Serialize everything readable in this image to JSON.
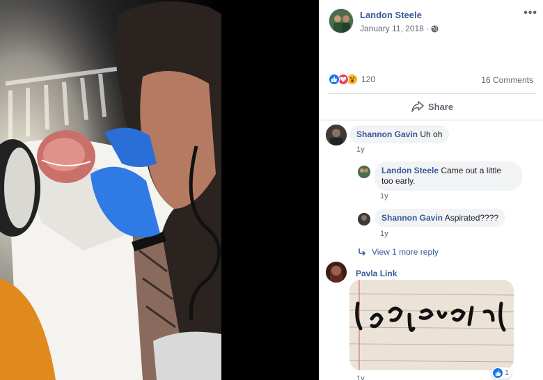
{
  "post": {
    "author": "Landon Steele",
    "date": "January 11, 2018 ·",
    "more_label": "•••",
    "reaction_count": "120",
    "comments_count": "16 Comments",
    "share_label": "Share",
    "reactions": [
      "like-icon",
      "love-icon",
      "wow-icon"
    ]
  },
  "comments": [
    {
      "author": "Shannon Gavin",
      "text": "Uh oh",
      "time": "1y"
    },
    {
      "author": "Landon Steele",
      "text": "Came out a little too early.",
      "time": "1y"
    },
    {
      "author": "Shannon Gavin",
      "text": "Aspirated????",
      "time": "1y"
    },
    {
      "author": "Pavla Link",
      "time": "1y",
      "reaction_count": "1"
    }
  ],
  "view_more_replies": "View 1 more reply",
  "colors": {
    "link_blue": "#385898",
    "like_blue": "#1877f2",
    "love_red": "#f33e58",
    "wow_yellow": "#f7b125",
    "bubble_gray": "#f2f3f5"
  }
}
